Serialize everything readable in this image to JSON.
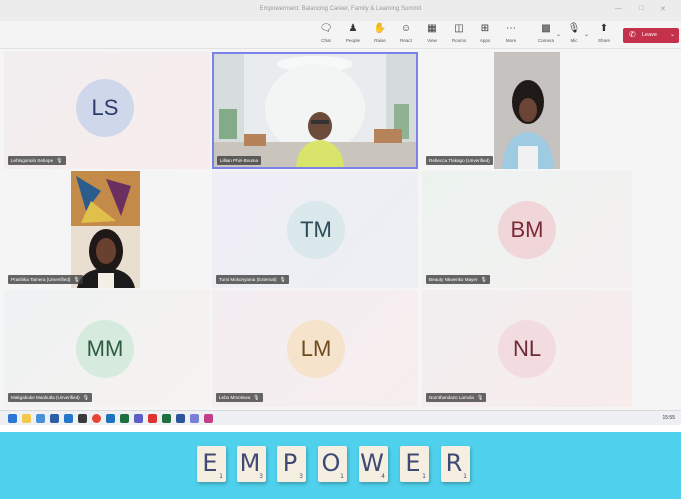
{
  "window": {
    "title": "Empowerment: Balancing Career, Family & Learning Summit"
  },
  "toolbar": {
    "items": [
      {
        "label": "Chat",
        "icon": "chat-icon"
      },
      {
        "label": "People",
        "icon": "people-icon"
      },
      {
        "label": "Raise",
        "icon": "raise-hand-icon"
      },
      {
        "label": "React",
        "icon": "react-icon"
      },
      {
        "label": "View",
        "icon": "view-icon"
      },
      {
        "label": "Rooms",
        "icon": "rooms-icon"
      },
      {
        "label": "Apps",
        "icon": "apps-icon"
      },
      {
        "label": "More",
        "icon": "more-icon"
      },
      {
        "label": "Camera",
        "icon": "camera-icon"
      },
      {
        "label": "Mic",
        "icon": "mic-icon"
      },
      {
        "label": "Share",
        "icon": "share-icon"
      }
    ],
    "leave_label": "Leave",
    "leave_color": "#c4314b"
  },
  "participants": [
    {
      "initials": "LS",
      "name": "Lehlogonolo Sebope",
      "video": false,
      "avatar_bg": "#cfd8ea",
      "avatar_fg": "#2e3c6c"
    },
    {
      "initials": "",
      "name": "Lillian Phiri-Bvuma",
      "video": true,
      "active_speaker": true
    },
    {
      "initials": "",
      "name": "Rebecca Tlakago (Unverified)",
      "video": true
    },
    {
      "initials": "",
      "name": "Prashika Tamera (Unverified)",
      "video": true
    },
    {
      "initials": "TM",
      "name": "Tumi Mokonyama (External)",
      "video": false,
      "avatar_bg": "#dbe8ec",
      "avatar_fg": "#2d4b55"
    },
    {
      "initials": "BM",
      "name": "Beauty Nkwenko Mayer",
      "video": false,
      "avatar_bg": "#f1d6d9",
      "avatar_fg": "#7a2a35"
    },
    {
      "initials": "MM",
      "name": "Makgabuke Maokutla (Unverified)",
      "video": false,
      "avatar_bg": "#d6ebde",
      "avatar_fg": "#2f5c3f"
    },
    {
      "initials": "LM",
      "name": "Lebo Mmotswa",
      "video": false,
      "avatar_bg": "#f6e3cc",
      "avatar_fg": "#6d4c20"
    },
    {
      "initials": "NL",
      "name": "Nomthandazo Lamola",
      "video": false,
      "avatar_bg": "#f3dcdf",
      "avatar_fg": "#6b2b35"
    }
  ],
  "taskbar": {
    "clock": "15:55"
  },
  "banner": {
    "bg_color": "#4fd0ec",
    "tiles": [
      {
        "letter": "E",
        "sub": "1"
      },
      {
        "letter": "M",
        "sub": "3"
      },
      {
        "letter": "P",
        "sub": "3"
      },
      {
        "letter": "O",
        "sub": "1"
      },
      {
        "letter": "W",
        "sub": "4"
      },
      {
        "letter": "E",
        "sub": "1"
      },
      {
        "letter": "R",
        "sub": "1"
      }
    ]
  }
}
